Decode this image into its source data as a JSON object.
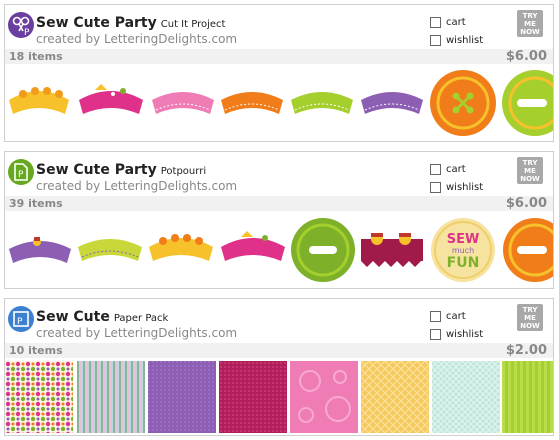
{
  "products": [
    {
      "icon": "scissors-icon",
      "name": "Sew Cute Party",
      "subtitle": "Cut It Project",
      "byline": "created by LetteringDelights.com",
      "cart_label": "cart",
      "wishlist_label": "wishlist",
      "try_label": [
        "TRY",
        "ME",
        "NOW"
      ],
      "items": "18 items",
      "price": "$6.00",
      "accent": "#6b3fa0"
    },
    {
      "icon": "document-icon",
      "name": "Sew Cute Party",
      "subtitle": "Potpourri",
      "byline": "created by LetteringDelights.com",
      "cart_label": "cart",
      "wishlist_label": "wishlist",
      "try_label": [
        "TRY",
        "ME",
        "NOW"
      ],
      "items": "39 items",
      "price": "$6.00",
      "accent": "#66a81f"
    },
    {
      "icon": "paper-icon",
      "name": "Sew Cute",
      "subtitle": "Paper Pack",
      "byline": "created by LetteringDelights.com",
      "cart_label": "cart",
      "wishlist_label": "wishlist",
      "try_label": [
        "TRY",
        "ME",
        "NOW"
      ],
      "items": "10 items",
      "price": "$2.00",
      "accent": "#3d7fd1"
    }
  ],
  "thumb_text": {
    "sew": "SEW",
    "much": "much",
    "fun": "FUN"
  },
  "colors": {
    "yellow": "#f6c12a",
    "pink": "#e0318a",
    "lightpink": "#f07cb5",
    "orange": "#f07d1a",
    "lime": "#a5cf2c",
    "purple": "#8c5fb5",
    "green": "#7fb02a",
    "maroon": "#a01a4a"
  }
}
